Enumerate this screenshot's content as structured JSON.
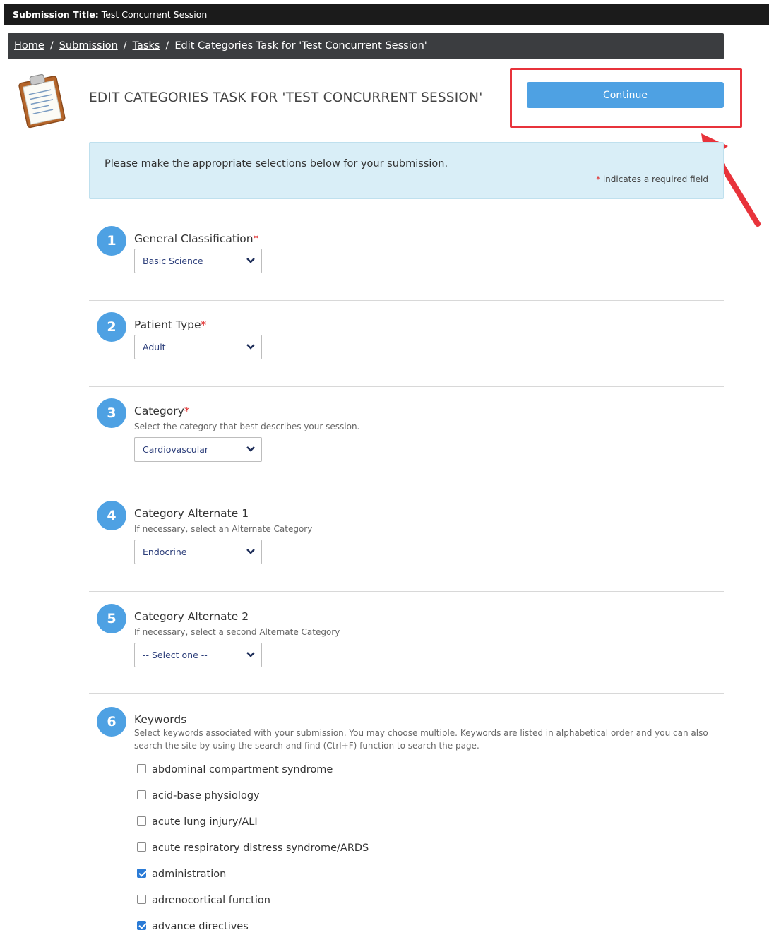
{
  "topbar": {
    "label": "Submission Title:",
    "value": "Test Concurrent Session"
  },
  "breadcrumb": {
    "home": "Home",
    "submission": "Submission",
    "tasks": "Tasks",
    "current": "Edit Categories Task for 'Test Concurrent Session'",
    "separator": "/"
  },
  "page": {
    "title": "EDIT CATEGORIES TASK FOR 'TEST CONCURRENT SESSION'",
    "continue_label": "Continue"
  },
  "info": {
    "message": "Please make the appropriate selections below for your submission.",
    "required_star": "*",
    "required_note": "indicates a required field"
  },
  "steps": [
    {
      "number": "1",
      "title": "General Classification",
      "required": "*",
      "help": "",
      "selected": "Basic Science"
    },
    {
      "number": "2",
      "title": "Patient Type",
      "required": "*",
      "help": "",
      "selected": "Adult"
    },
    {
      "number": "3",
      "title": "Category",
      "required": "*",
      "help": "Select the category that best describes your session.",
      "selected": "Cardiovascular"
    },
    {
      "number": "4",
      "title": "Category Alternate 1",
      "required": "",
      "help": "If necessary, select an Alternate Category",
      "selected": "Endocrine"
    },
    {
      "number": "5",
      "title": "Category Alternate 2",
      "required": "",
      "help": "If necessary, select a second Alternate Category",
      "selected": "-- Select one --"
    }
  ],
  "keywords": {
    "number": "6",
    "title": "Keywords",
    "help": "Select keywords associated with your submission. You may choose multiple. Keywords are listed in alphabetical order and you can also search the site by using the search and find (Ctrl+F) function to search the page.",
    "items": [
      {
        "label": "abdominal compartment syndrome",
        "checked": false
      },
      {
        "label": "acid-base physiology",
        "checked": false
      },
      {
        "label": "acute lung injury/ALI",
        "checked": false
      },
      {
        "label": "acute respiratory distress syndrome/ARDS",
        "checked": false
      },
      {
        "label": "administration",
        "checked": true
      },
      {
        "label": "adrenocortical function",
        "checked": false
      },
      {
        "label": "advance directives",
        "checked": true
      }
    ]
  },
  "colors": {
    "accent": "#4ea1e3",
    "highlight": "#e8333b",
    "info_bg": "#d9eef7",
    "topbar": "#1b1b1b",
    "breadcrumb_bg": "#3b3d40"
  },
  "icons": {
    "clipboard": "clipboard-icon",
    "chevron": "chevron-down-icon",
    "arrow": "red-arrow-annotation"
  }
}
